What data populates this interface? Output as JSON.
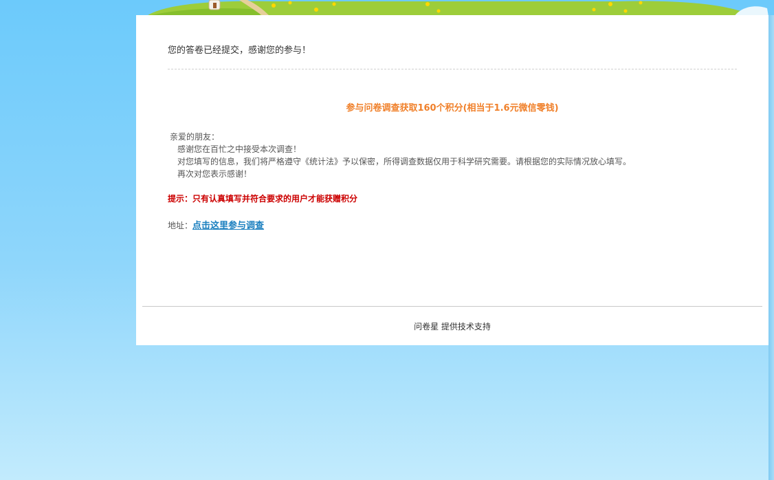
{
  "message": {
    "submitted": "您的答卷已经提交，感谢您的参与！"
  },
  "headline": "参与问卷调查获取160个积分(相当于1.6元微信零钱)",
  "letter": {
    "greeting": "亲爱的朋友：",
    "line1": "感谢您在百忙之中接受本次调查！",
    "line2": "对您填写的信息，我们将严格遵守《统计法》予以保密，所得调查数据仅用于科学研究需要。请根据您的实际情况放心填写。",
    "line3": "再次对您表示感谢！"
  },
  "tip": "提示：只有认真填写并符合要求的用户才能获赠积分",
  "address": {
    "label": "地址：",
    "link_text": "点击这里参与调查"
  },
  "footer": {
    "text": "问卷星 提供技术支持"
  },
  "colors": {
    "headline": "#f0802a",
    "tip": "#cc0000",
    "link": "#1a7fbf",
    "background": "#6ccafb"
  },
  "icons": {
    "banner": "meadow-banner-icon",
    "house": "house-icon"
  }
}
